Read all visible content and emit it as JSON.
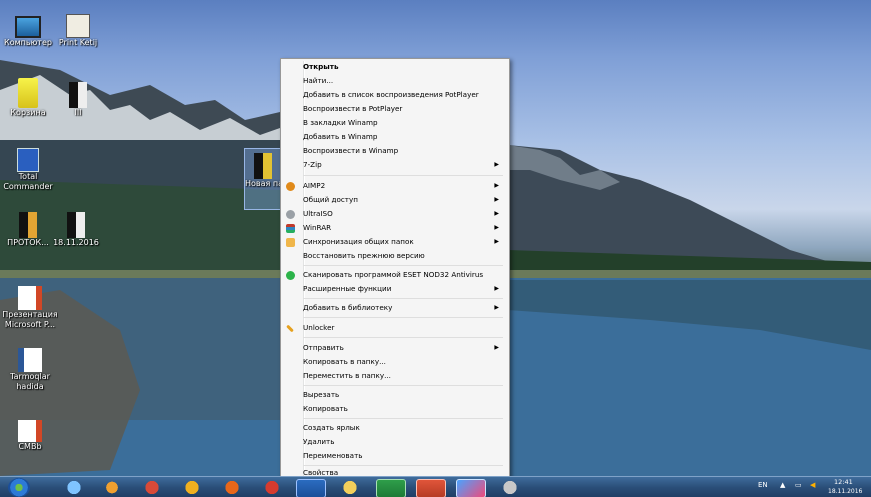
{
  "desktop_icons": [
    {
      "label": "Компьютер",
      "icon": "computer-icon"
    },
    {
      "label": "Print Ketij",
      "icon": "book-icon"
    },
    {
      "label": "Корзина",
      "icon": "recycle-bin-icon"
    },
    {
      "label": "III",
      "icon": "file-icon"
    },
    {
      "label": "Total Commander",
      "icon": "floppy-icon"
    },
    {
      "label": "ПРОТОК...",
      "icon": "file-icon"
    },
    {
      "label": "18.11.2016",
      "icon": "file-icon"
    },
    {
      "label": "Презентация Microsoft P...",
      "icon": "powerpoint-icon"
    },
    {
      "label": "Tarmoqlar hadida",
      "icon": "word-icon"
    },
    {
      "label": "CMBb",
      "icon": "powerpoint-icon"
    },
    {
      "label": "Новая папка ...",
      "icon": "folder-icon"
    }
  ],
  "context_menu": {
    "items": [
      {
        "label": "Открыть",
        "bold": true
      },
      {
        "label": "Найти..."
      },
      {
        "label": "Добавить в список воспроизведения PotPlayer"
      },
      {
        "label": "Воспроизвести в PotPlayer"
      },
      {
        "label": "В закладки Winamp"
      },
      {
        "label": "Добавить в Winamp"
      },
      {
        "label": "Воспроизвести в Winamp"
      },
      {
        "label": "7-Zip",
        "submenu": true
      },
      {
        "label": "AIMP2",
        "submenu": true,
        "icon": "aimp-icon"
      },
      {
        "label": "Общий доступ",
        "submenu": true
      },
      {
        "label": "UltraISO",
        "submenu": true,
        "icon": "ultraiso-icon"
      },
      {
        "label": "WinRAR",
        "submenu": true,
        "icon": "winrar-icon"
      },
      {
        "label": "Синхронизация общих папок",
        "submenu": true,
        "icon": "sync-icon"
      },
      {
        "label": "Восстановить прежнюю версию"
      },
      {
        "label": "Сканировать программой ESET NOD32 Antivirus",
        "icon": "eset-icon"
      },
      {
        "label": "Расширенные функции",
        "submenu": true
      },
      {
        "label": "Добавить в библиотеку",
        "submenu": true
      },
      {
        "label": "Unlocker",
        "icon": "unlocker-icon"
      },
      {
        "label": "Отправить",
        "submenu": true
      },
      {
        "label": "Копировать в папку..."
      },
      {
        "label": "Переместить в папку..."
      },
      {
        "label": "Вырезать"
      },
      {
        "label": "Копировать"
      },
      {
        "label": "Создать ярлык"
      },
      {
        "label": "Удалить"
      },
      {
        "label": "Переименовать"
      },
      {
        "label": "Свойства"
      }
    ]
  },
  "taskbar": {
    "apps": [
      "start-orb",
      "ie-icon",
      "media-player-icon",
      "chrome-icon",
      "aimp-icon",
      "firefox-icon",
      "opera-icon",
      "word-icon",
      "explorer-icon",
      "excel-icon",
      "powerpoint-icon",
      "paint-icon",
      "settings-icon"
    ],
    "lang": "EN",
    "clock_time": "12:41",
    "clock_date": "18.11.2016"
  }
}
